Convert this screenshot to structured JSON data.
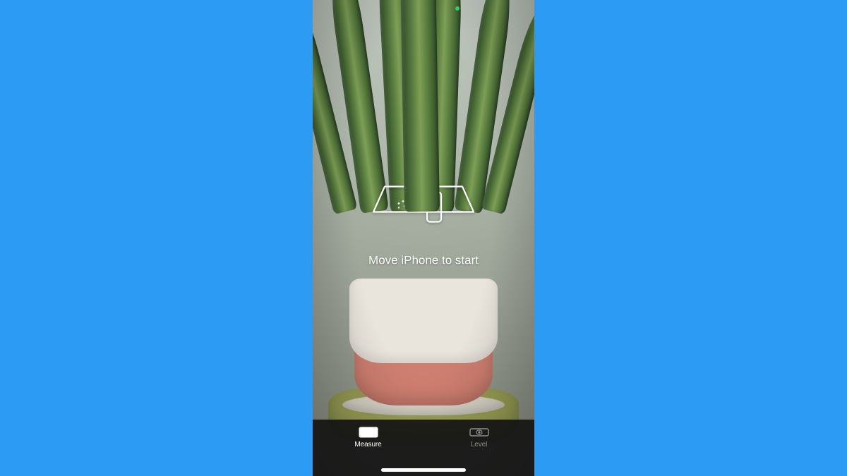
{
  "colors": {
    "page_background": "#2b9bf3",
    "camera_indicator": "#30d158",
    "tabbar_background": "rgba(20,20,20,0.92)",
    "tab_inactive": "#8e8e93",
    "tab_active": "#ffffff"
  },
  "status": {
    "camera_active": true
  },
  "ar": {
    "hint_text": "Move iPhone to start",
    "motion_icon_name": "move-phone-over-plane-icon"
  },
  "tabbar": {
    "items": [
      {
        "id": "measure",
        "label": "Measure",
        "icon": "ruler-icon",
        "active": true
      },
      {
        "id": "level",
        "label": "Level",
        "icon": "level-icon",
        "active": false
      }
    ],
    "home_indicator": true
  }
}
